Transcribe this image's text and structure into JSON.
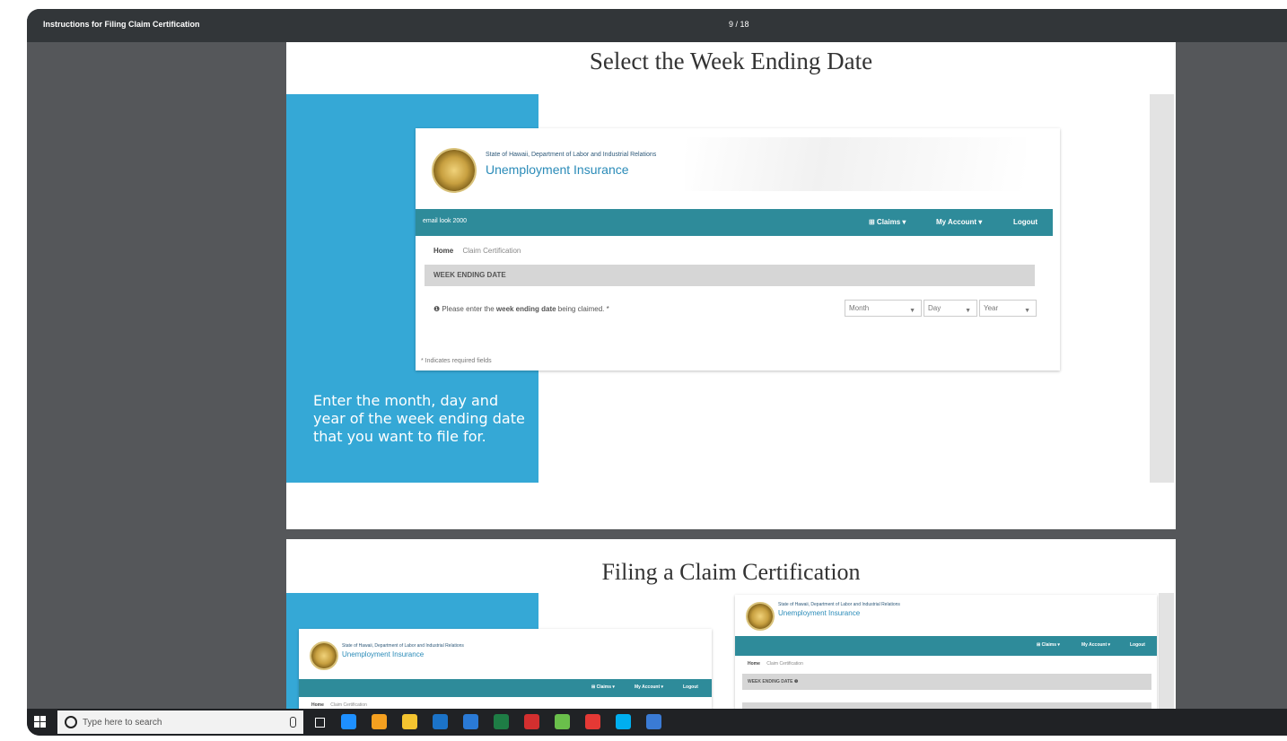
{
  "viewer": {
    "document_title": "Instructions for Filing Claim Certification",
    "page_indicator": "9 / 18"
  },
  "slide1": {
    "title": "Select the Week Ending Date",
    "screen": {
      "agency": "State of Hawaii, Department of Labor and Industrial Relations",
      "program": "Unemployment Insurance",
      "user_label": "email look 2000",
      "nav": {
        "claims": "⊞ Claims ▾",
        "account": "My Account ▾",
        "logout": "Logout"
      },
      "breadcrumb": {
        "home": "Home",
        "current": "Claim Certification"
      },
      "section_header": "WEEK ENDING DATE",
      "prompt_prefix": "❶ Please enter the ",
      "prompt_bold": "week ending date",
      "prompt_suffix": " being claimed. *",
      "selects": {
        "month": "Month",
        "day": "Day",
        "year": "Year"
      },
      "required_note": "* Indicates required fields"
    },
    "callout": "Enter the month, day and year of the week ending date that you want to file for."
  },
  "slide2": {
    "title": "Filing a Claim Certification",
    "left_screen": {
      "agency": "State of Hawaii, Department of Labor and Industrial Relations",
      "program": "Unemployment Insurance",
      "nav": {
        "claims": "⊞ Claims ▾",
        "account": "My Account ▾",
        "logout": "Logout"
      },
      "breadcrumb": {
        "home": "Home",
        "current": "Claim Certification"
      }
    },
    "right_screen": {
      "agency": "State of Hawaii, Department of Labor and Industrial Relations",
      "program": "Unemployment Insurance",
      "nav": {
        "claims": "⊞ Claims ▾",
        "account": "My Account ▾",
        "logout": "Logout"
      },
      "breadcrumb": {
        "home": "Home",
        "current": "Claim Certification"
      },
      "section_header": "WEEK ENDING DATE ❶"
    }
  },
  "taskbar": {
    "search_placeholder": "Type here to search",
    "icons": [
      "task-view-icon",
      "edge-browser-icon",
      "chrome-icon",
      "file-explorer-icon",
      "outlook-icon",
      "people-icon",
      "excel-icon",
      "acrobat-icon",
      "slack-icon",
      "opera-icon",
      "skype-icon",
      "app-icon"
    ],
    "accent_colors": [
      "#1e90ff",
      "#f4a020",
      "#f4c430",
      "#1b73c8",
      "#2a7ad6",
      "#1e7d45",
      "#d32f2f",
      "#6abf4b",
      "#e53935",
      "#00aff0",
      "#3a7bd5"
    ]
  }
}
